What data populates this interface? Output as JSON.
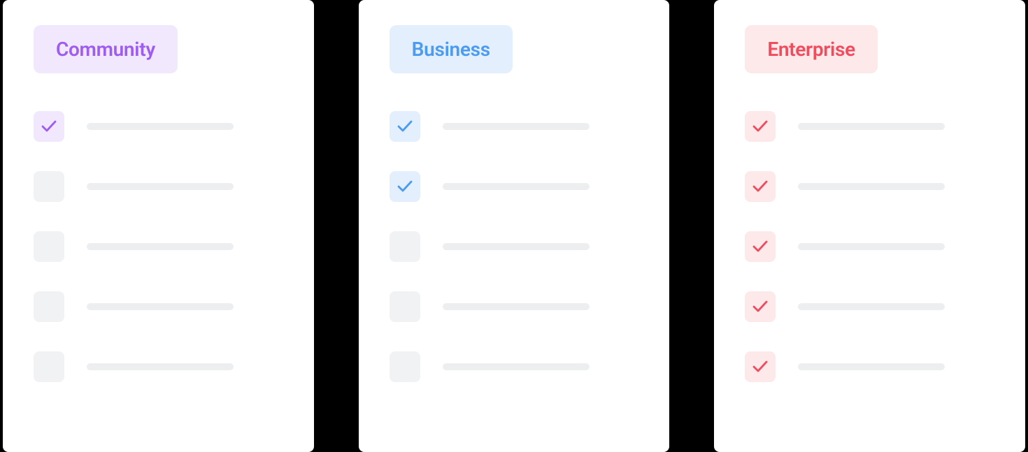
{
  "tiers": [
    {
      "key": "community",
      "label": "Community",
      "features": [
        true,
        false,
        false,
        false,
        false
      ]
    },
    {
      "key": "business",
      "label": "Business",
      "features": [
        true,
        true,
        false,
        false,
        false
      ]
    },
    {
      "key": "enterprise",
      "label": "Enterprise",
      "features": [
        true,
        true,
        true,
        true,
        true
      ]
    }
  ]
}
